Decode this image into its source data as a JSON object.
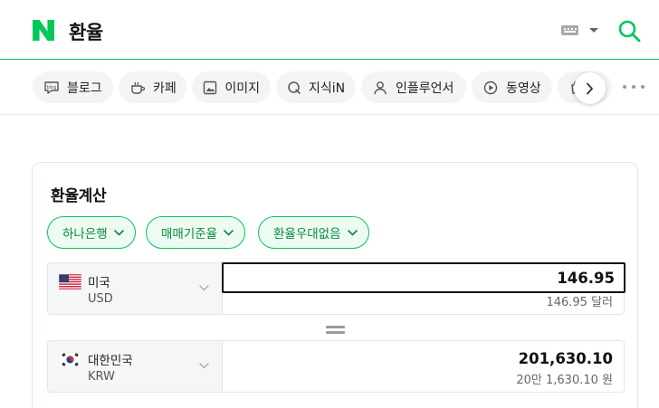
{
  "header": {
    "query": "환율",
    "colors": {
      "brand": "#03c75a"
    },
    "icons": [
      "naver-logo-icon",
      "keyboard-icon",
      "caret-down-icon",
      "search-icon"
    ]
  },
  "tabs": {
    "items": [
      {
        "label": "블로그",
        "icon": "blog-icon"
      },
      {
        "label": "카페",
        "icon": "cafe-icon"
      },
      {
        "label": "이미지",
        "icon": "image-icon"
      },
      {
        "label": "지식iN",
        "icon": "knowledge-icon"
      },
      {
        "label": "인플루언서",
        "icon": "person-icon"
      },
      {
        "label": "동영상",
        "icon": "video-icon"
      },
      {
        "label": "",
        "icon": "shopping-icon"
      }
    ],
    "next_icon": "chevron-right-icon",
    "more_icon": "more-dots-icon"
  },
  "converter": {
    "title": "환율계산",
    "filters": [
      {
        "label": "하나은행"
      },
      {
        "label": "매매기준율"
      },
      {
        "label": "환율우대없음"
      }
    ],
    "from": {
      "country": "미국",
      "code": "USD",
      "flag": "us-flag-icon",
      "value": "146.95",
      "sub": "146.95 달러"
    },
    "to": {
      "country": "대한민국",
      "code": "KRW",
      "flag": "kr-flag-icon",
      "value": "201,630.10",
      "sub": "20만 1,630.10 원"
    }
  }
}
